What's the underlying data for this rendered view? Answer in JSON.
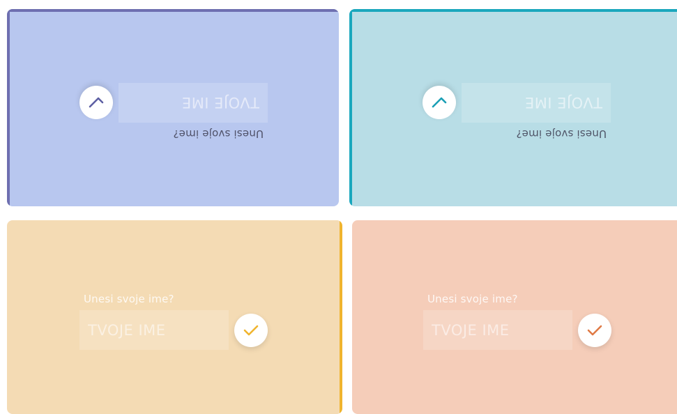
{
  "cards": [
    {
      "id": "card-1",
      "prompt": "Unesi svoje ime?",
      "placeholder": "TVOJE IME",
      "icon": "check-icon",
      "colors": {
        "background": "#b8c7ef",
        "accent": "#6e6fb0",
        "icon": "#5d5fa3"
      }
    },
    {
      "id": "card-2",
      "prompt": "Unesi svoje ime?",
      "placeholder": "TVOJE IME",
      "icon": "check-icon",
      "colors": {
        "background": "#b8dde6",
        "accent": "#1aa7bd",
        "icon": "#1a9fb5"
      }
    },
    {
      "id": "card-3",
      "prompt": "Unesi svoje ime?",
      "placeholder": "TVOJE IME",
      "icon": "check-icon",
      "colors": {
        "background": "#f4dbb4",
        "accent": "#f0b42e",
        "icon": "#f0b42e"
      }
    },
    {
      "id": "card-4",
      "prompt": "Unesi svoje ime?",
      "placeholder": "TVOJE IME",
      "icon": "check-icon",
      "colors": {
        "background": "#f5cdb9",
        "accent": "#f5cdb9",
        "icon": "#e07a45"
      }
    }
  ]
}
